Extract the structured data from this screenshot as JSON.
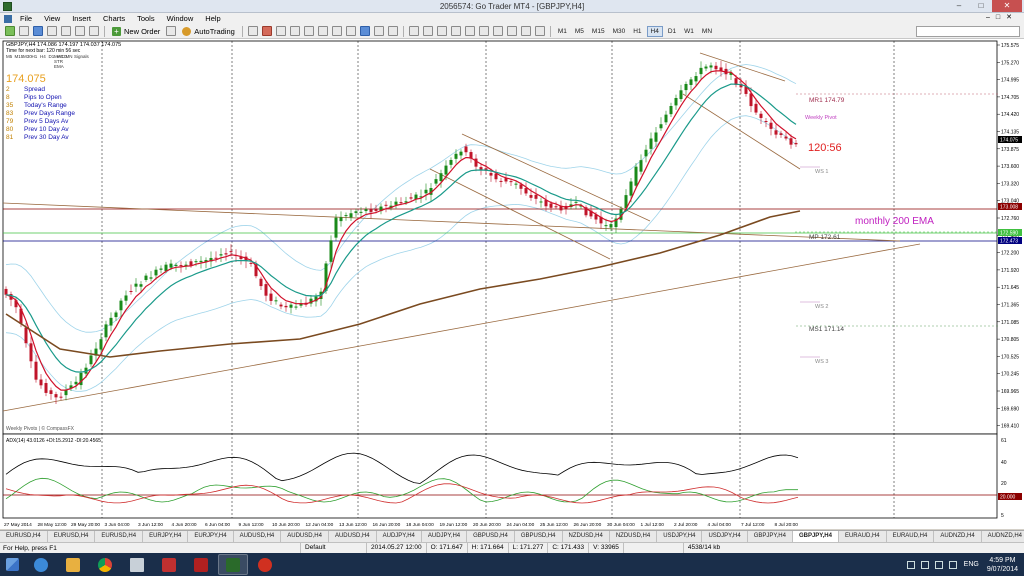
{
  "window": {
    "title": "2056574: Go Trader MT4 - [GBPJPY,H4]"
  },
  "menu": [
    "File",
    "View",
    "Insert",
    "Charts",
    "Tools",
    "Window",
    "Help"
  ],
  "toolbar": {
    "new_order": "New Order",
    "autotrading": "AutoTrading",
    "timeframes": [
      "M1",
      "M5",
      "M15",
      "M30",
      "H1",
      "H4",
      "D1",
      "W1",
      "MN"
    ],
    "active_timeframe": "H4"
  },
  "chart": {
    "header": "GBPJPY,H4  174.086 174.197 174.037 174.075",
    "time_line": "Time for next bar: 120 min 56 sec",
    "tf_row": [
      "M5",
      "M15",
      "M30",
      "H1",
      "H4",
      "D1",
      "W1",
      "MN",
      "Signals"
    ],
    "indicators": [
      "MACD",
      "STR",
      "EMA"
    ],
    "price": "174.075",
    "stats": [
      {
        "value": "2",
        "label": "Spread"
      },
      {
        "value": "8",
        "label": "Pips to Open"
      },
      {
        "value": "35",
        "label": "Today's Range"
      },
      {
        "value": "83",
        "label": "Prev Days Range"
      },
      {
        "value": "79",
        "label": "Prev 5 Days Av"
      },
      {
        "value": "80",
        "label": "Prev 10 Day Av"
      },
      {
        "value": "81",
        "label": "Prev 30 Day Av"
      }
    ],
    "price_axis": [
      "175.575",
      "175.270",
      "174.995",
      "174.705",
      "174.420",
      "174.135",
      "173.875",
      "173.600",
      "173.320",
      "173.040",
      "172.760",
      "172.480",
      "172.200",
      "171.920",
      "171.645",
      "171.365",
      "171.085",
      "170.805",
      "170.525",
      "170.245",
      "169.965",
      "169.690",
      "169.410"
    ],
    "current_price_tag": "174.075",
    "line_tags": [
      "173.008",
      "172.590",
      "172.473"
    ],
    "pivots": {
      "mr1": "MR1   174.79",
      "weekly_pivot": "Weekly Pivot",
      "ws1": "WS 1",
      "mp": "MP   172.61",
      "ws2": "WS 2",
      "ms1": "MS1   171.14",
      "ws3": "WS 3"
    },
    "countdown": "120:56",
    "monthly_label": "monthly 200 EMA",
    "watermark": "Weekly Pivots | © CompassFX",
    "adx_header": "ADX(14) 43.0126 +DI:15.2912 -DI:20.4565",
    "adx_axis": [
      "61",
      "40",
      "20",
      "20.000",
      "5"
    ],
    "time_axis": [
      "27 May 2014",
      "28 May 12:00",
      "29 May 20:00",
      "3 Jun 04:00",
      "3 Jun 12:00",
      "4 Jun 20:00",
      "6 Jun 04:00",
      "9 Jun 12:00",
      "10 Jun 20:00",
      "12 Jun 04:00",
      "13 Jun 12:00",
      "16 Jun 20:00",
      "18 Jun 04:00",
      "19 Jun 12:00",
      "20 Jun 20:00",
      "24 Jun 04:00",
      "25 Jun 12:00",
      "26 Jun 20:00",
      "30 Jun 04:00",
      "1 Jul 12:00",
      "2 Jul 20:00",
      "4 Jul 04:00",
      "7 Jul 12:00",
      "8 Jul 20:00"
    ]
  },
  "tabs": [
    "EURUSD,H4",
    "EURUSD,H4",
    "EURUSD,H4",
    "EURJPY,H4",
    "EURJPY,H4",
    "AUDUSD,H4",
    "AUDUSD,H4",
    "AUDUSD,H4",
    "AUDJPY,H4",
    "AUDJPY,H4",
    "GBPUSD,H4",
    "GBPUSD,H4",
    "NZDUSD,H4",
    "NZDUSD,H4",
    "USDJPY,H4",
    "USDJPY,H4",
    "GBPJPY,H4",
    "GBPJPY,H4",
    "EURAUD,H4",
    "EURAUD,H4",
    "AUDNZD,H4",
    "AUDNZD,H4",
    "GBPAUD,H4",
    "GBPAUD,H4"
  ],
  "active_tab_index": 17,
  "status": {
    "help": "For Help, press F1",
    "profile": "Default",
    "time": "2014.05.27 12:00",
    "open": "O: 171.647",
    "high": "H: 171.664",
    "low": "L: 171.277",
    "close": "C: 171.433",
    "volume": "V: 33965",
    "traffic": "4538/14 kb"
  },
  "taskbar": {
    "time": "4:59 PM",
    "date": "9/07/2014",
    "lang": "ENG"
  },
  "colors": {
    "bull": "#1a8a1a",
    "bear": "#c0152a",
    "ema_red": "#d0102a",
    "ema_teal": "#1a9a8a",
    "ema_brown": "#7a4a20",
    "bands": "#9fd4ea",
    "monthly": "#c020c0",
    "countdown": "#e02020"
  }
}
